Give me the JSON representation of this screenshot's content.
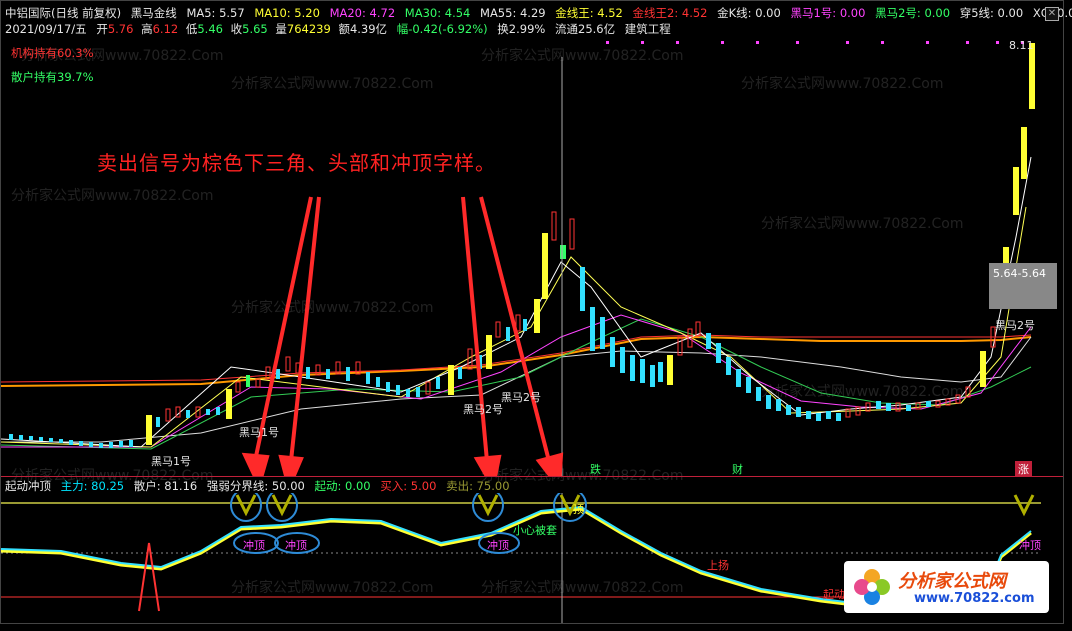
{
  "header": {
    "stock_name": "中铝国际(日线 前复权)",
    "indicator_name": "黑马金线",
    "ma5": "MA5: 5.57",
    "ma10": "MA10: 5.20",
    "ma20": "MA20: 4.72",
    "ma30": "MA30: 4.54",
    "ma55": "MA55: 4.29",
    "jxw": "金线王: 4.52",
    "jxw2": "金线王2: 4.52",
    "jk": "金K线: 0.00",
    "hm1": "黑马1号: 0.00",
    "hm2": "黑马2号: 0.00",
    "c5": "穿5线: 0.00",
    "xg": "XG: 0.00"
  },
  "quote": {
    "date": "2021/09/17/五",
    "open_label": "开",
    "open": "5.76",
    "high_label": "高",
    "high": "6.12",
    "low_label": "低",
    "low": "5.46",
    "close_label": "收",
    "close": "5.65",
    "vol_label": "量",
    "vol": "764239",
    "amt": "额4.39亿",
    "chg": "幅-0.42(-6.92%)",
    "turnover": "换2.99%",
    "float": "流通25.6亿",
    "industry": "建筑工程"
  },
  "stats": {
    "inst": "机构持有60.3%",
    "retail": "散户持有39.7%"
  },
  "annotation": "卖出信号为棕色下三角、头部和冲顶字样。",
  "chart": {
    "top_price": "8.11",
    "price_box": "5.64-5.64",
    "labels": [
      "黑马1号",
      "黑马1号",
      "黑马2号",
      "黑马2号",
      "黑马2号"
    ],
    "events": [
      "跌",
      "财",
      "涨"
    ]
  },
  "sub": {
    "title": "起动冲顶",
    "main": "主力: 80.25",
    "retail": "散户: 81.16",
    "strength": "强弱分界线: 50.00",
    "qidong": "起动: 0.00",
    "buy": "买入: 5.00",
    "sell": "卖出: 75.00",
    "signal": "冲顶",
    "caution": "小心被套",
    "rise": "上扬",
    "start": "起动",
    "top_short": "顶"
  },
  "watermark": "分析家公式网www.70822.Com",
  "logo": {
    "name": "分析家公式网",
    "url": "www.70822.com"
  },
  "colors": {
    "bg": "#000000",
    "up": "#ff3333",
    "down": "#33e0ff",
    "gold": "#ffff33",
    "arrow": "#ff2a2a",
    "circle": "#2e8bd6"
  }
}
